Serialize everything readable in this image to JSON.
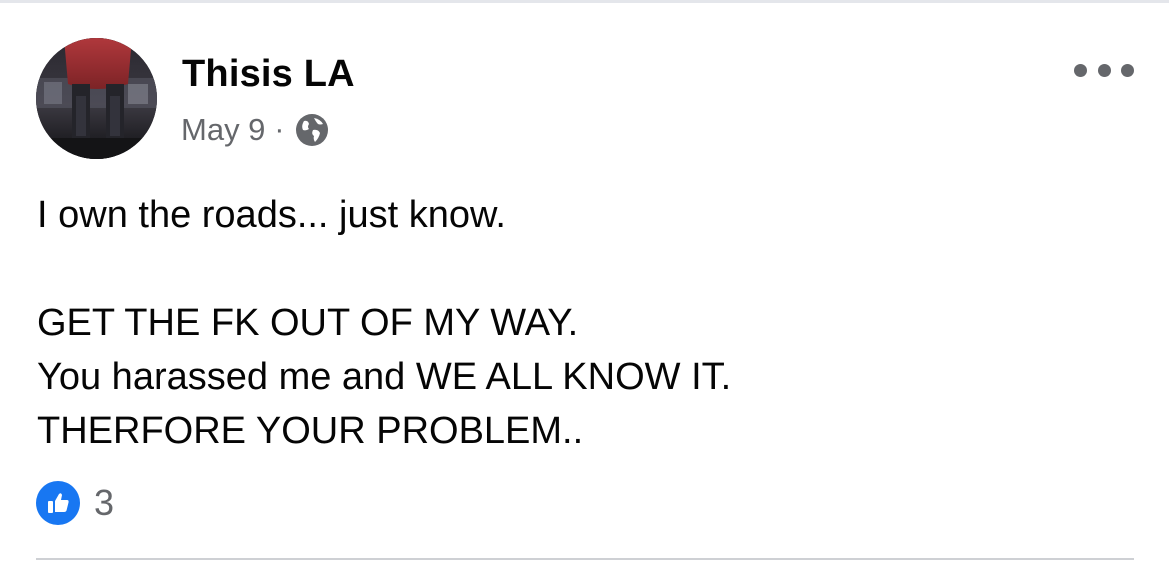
{
  "post": {
    "author": {
      "name": "Thisis LA"
    },
    "meta": {
      "date": "May 9",
      "separator": "·",
      "audience_icon": "globe-icon"
    },
    "more_options_icon": "more-horizontal-icon",
    "body_lines": [
      "I own the roads... just know.",
      "",
      "GET THE FK OUT OF MY WAY.",
      "You harassed me and WE ALL KNOW IT.",
      "THERFORE YOUR PROBLEM.."
    ],
    "reactions": {
      "icon": "like-icon",
      "count": "3"
    }
  },
  "colors": {
    "text_primary": "#050505",
    "text_secondary": "#65676b",
    "like_blue": "#1877f2",
    "divider": "#ced0d4"
  }
}
